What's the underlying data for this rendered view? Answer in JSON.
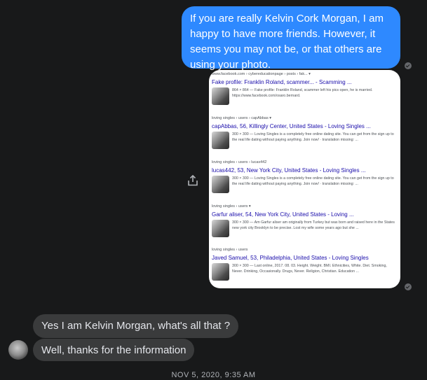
{
  "messages": {
    "outgoing_text": "If you are really Kelvin Cork Morgan, I am happy to have more friends. However, it seems you may not be, or that others are using your photo.",
    "incoming_1": "Yes I am Kelvin Morgan, what's all that ?",
    "incoming_2": "Well, thanks for the information",
    "timestamp": "NOV 5, 2020, 9:35 AM"
  },
  "search_results": [
    {
      "crumb": "www.facebook.com › cybereducationpage › posts › fak... ▾",
      "title": "Fake profile: Franklin Roland, scammer... - Scamming ...",
      "snippet": "864 × 864 — Fake profile: Franklin Roland, scammer left his pics open, he is married. https://www.facebook.com/osaro.bernard."
    },
    {
      "crumb": "loving singles › users › capAbbas ▾",
      "title": "capAbbas, 56, Killingly Center, United States - Loving Singles ...",
      "snippet": "300 × 300 — Loving Singles is a completely free online dating site. You can get from the sign up to the real life dating without paying anything. Join now! · translation missing: ..."
    },
    {
      "crumb": "loving singles › users › lucas442",
      "title": "lucas442, 53, New York City, United States - Loving Singles ...",
      "snippet": "300 × 300 — Loving Singles is a completely free online dating site. You can get from the sign up to the real life dating without paying anything. Join now! · translation missing: ..."
    },
    {
      "crumb": "loving singles › users ▾",
      "title": "Garfur aliser, 54, New York City, United States - Loving ...",
      "snippet": "300 × 300 — Am Garfur aliser am originally from Turkey but was born and raised here in the States new york city Brooklyn to be precise. Lost my wife some years ago but she ..."
    },
    {
      "crumb": "loving singles › users",
      "title": "Javed Samuel, 53, Philadelphia, United States - Loving Singles",
      "snippet": "300 × 300 — Last online, 2017. 08. 03. Height. Weight. BMI. Ethnicities, White. Diet. Smoking, Never. Drinking, Occasionally. Drugs, Never. Religion, Christian. Education ..."
    }
  ],
  "icons": {
    "share": "share-icon",
    "seen": "seen-check-icon",
    "avatar": "contact-avatar"
  },
  "colors": {
    "background": "#18191a",
    "outgoing_bubble": "#2e89ff",
    "incoming_bubble": "#3a3b3c",
    "link_blue": "#1a0dab"
  }
}
